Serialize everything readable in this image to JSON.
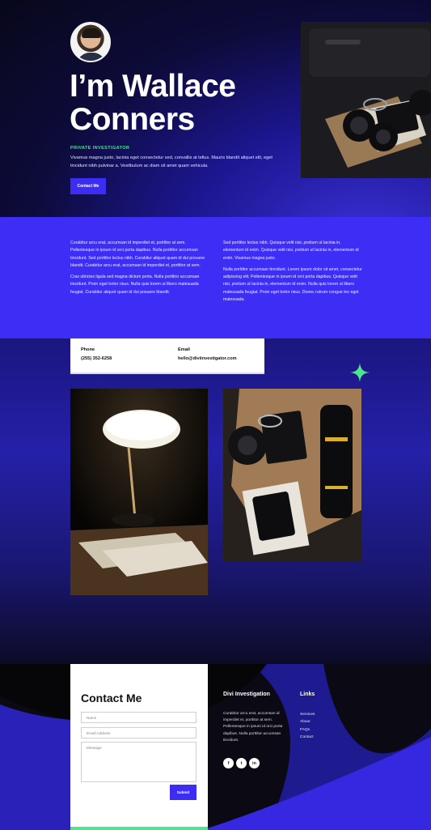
{
  "hero": {
    "title": "I’m Wallace Conners",
    "eyebrow": "PRIVATE INVESTIGATOR",
    "text": "Vivamus magna justo, lacinia eget consectetur sed, convallis at tellus. Mauris blandit aliquet elit, eget tincidunt nibh pulvinar a. Vestibulum ac diam sit amet quam vehicula.",
    "button": "Contact Me"
  },
  "about": {
    "left": [
      "Curabitur arcu erat, accumsan id imperdiet et, porttitor at sem. Pellentesque in ipsum id orci porta dapibus. Nulla porttitor accumsan tincidunt. Sed porttitor lectus nibh. Curabitur aliquet quam id dui posuere blandit. Curabitur arcu erat, accumsan id imperdiet et, porttitor at sem.",
      "Cras ultricies ligula sed magna dictum porta. Nulla porttitor accumsan tincidunt. Proin eget tortor risus. Nulla quis lorem ut libero malesuada feugiat. Curabitur aliquet quam id dui posuere blandit."
    ],
    "right": [
      "Sed porttitor lectus nibh. Quisque velit nisi, pretium ut lacinia in, elementum id enim. Quisque velit nisi, pretium ut lacinia in, elementum id enim. Vivamus magna justo.",
      "Nulla porttitor accumsan tincidunt. Lorem ipsum dolor sit amet, consectetur adipiscing elit. Pellentesque in ipsum id orci porta dapibus. Quisque velit nisi, pretium ut lacinia in, elementum id enim. Nulla quis lorem ut libero malesuada feugiat. Proin eget tortor risus. Donec rutrum congue leo eget malesuada."
    ]
  },
  "contact_info": {
    "phone_label": "Phone",
    "phone": "(255) 352-6258",
    "email_label": "Email",
    "email": "hello@diviinvestigator.com"
  },
  "form": {
    "title": "Contact Me",
    "name_placeholder": "Name",
    "email_placeholder": "Email Address",
    "message_placeholder": "Message",
    "submit": "Submit"
  },
  "footer": {
    "brand_title": "Divi Investigation",
    "brand_text": "Curabitur arcu erat, accumsan id imperdiet et, porttitor at sem. Pellentesque in ipsum id orci porta dapibus. Nulla porttitor accumsan tincidunt.",
    "links_title": "Links",
    "links": [
      "Services",
      "About",
      "FAQs",
      "Contact"
    ],
    "social": [
      {
        "icon": "facebook-icon",
        "glyph": "f"
      },
      {
        "icon": "twitter-icon",
        "glyph": "t"
      },
      {
        "icon": "linkedin-icon",
        "glyph": "in"
      }
    ]
  },
  "colors": {
    "accent": "#3d2df5",
    "green": "#4ee38f",
    "dark": "#060608"
  }
}
